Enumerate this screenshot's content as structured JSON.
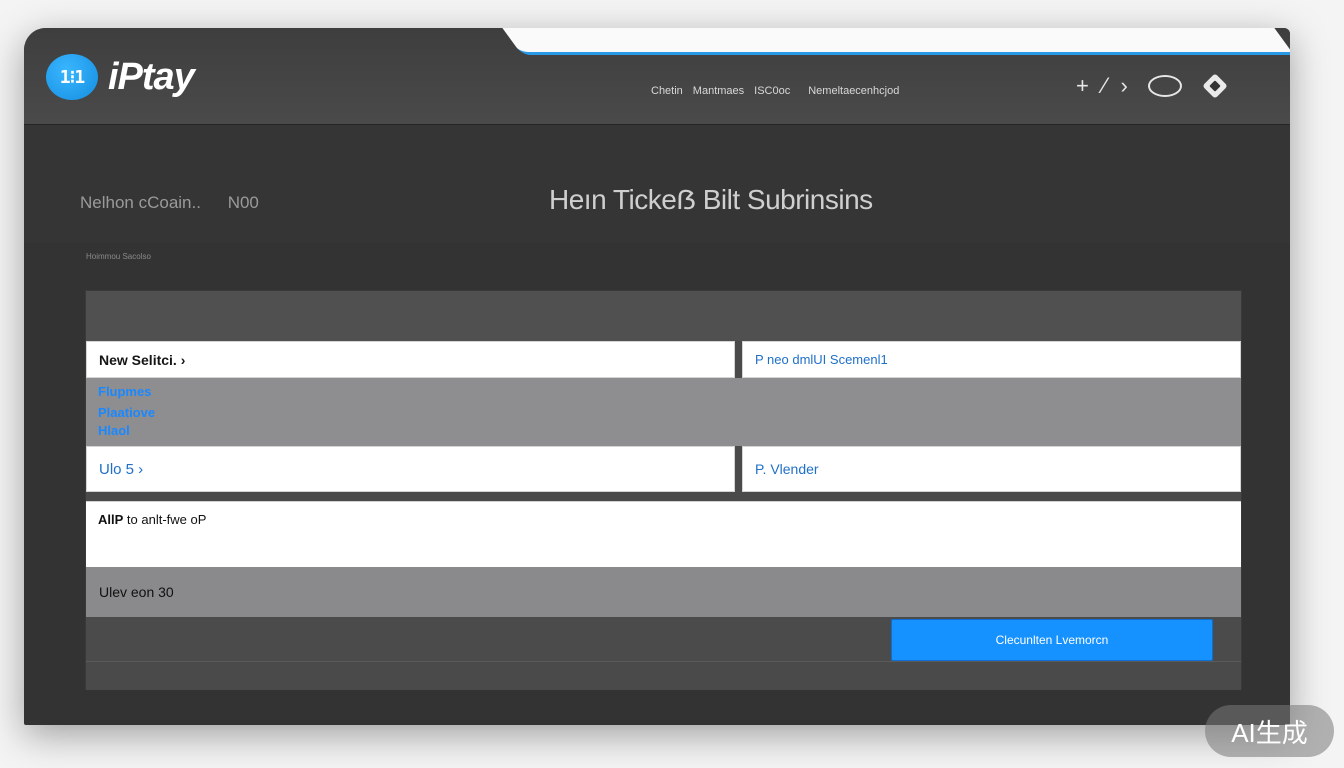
{
  "app": {
    "logo_mark": "1&#8203;1",
    "logo_text": "iPtay"
  },
  "topnav": {
    "items": [
      "Chetin",
      "Mantmaes",
      "ISC0oc",
      "Nemeltaecenhcjod"
    ]
  },
  "toolbar_icons": [
    "plus-icon",
    "pen-icon",
    "tag-icon",
    "cloud-icon",
    "diamond-icon"
  ],
  "header": {
    "left_label": "Nelhon cCoain..",
    "left_count": "N00",
    "title": "Heın Tickeẞ Bilt Subrinsins",
    "sub_crumb": "Hoimmou Sacolso"
  },
  "form": {
    "field_top_left": "New Selitci. ›",
    "field_top_right": "P  neo dmlUI Scemenl1",
    "options": [
      "Flupmes",
      "Plaatiove",
      "Hlaol"
    ],
    "field_mid_left": "Ulo  5  ›",
    "field_mid_right": "P. Vlender",
    "textarea_label": "AllP",
    "textarea_text": "to  anlt-fwe oP",
    "strip_text": "Ulev eon 30",
    "submit_label": "Clecunlten Lvemorcn"
  },
  "watermark": "AI生成",
  "colors": {
    "accent": "#1592ff",
    "window_bg": "#333333",
    "link_blue": "#1a88ff"
  }
}
